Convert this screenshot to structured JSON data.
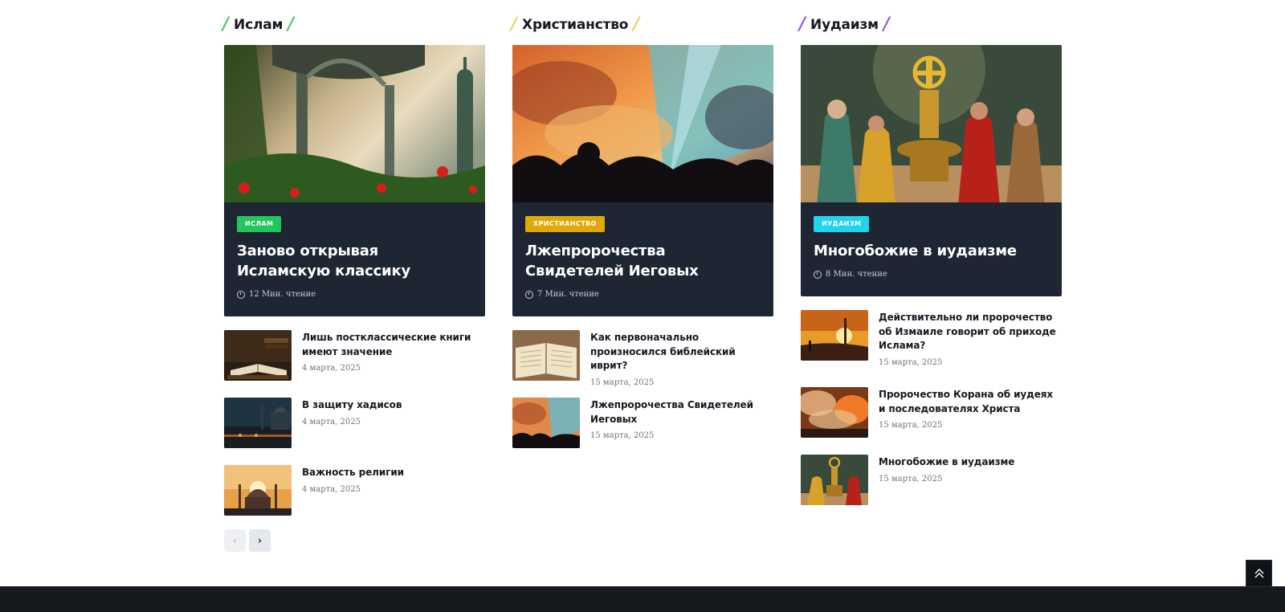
{
  "sections": [
    {
      "title": "Ислам",
      "slash_color": "#5cc46a",
      "featured": {
        "badge": "Ислам",
        "badge_color": "#22c55e",
        "title": "Заново открывая Исламскую классику",
        "read_time": "12 Мин. чтение"
      },
      "posts": [
        {
          "title": "Лишь постклассические книги имеют значение",
          "date": "4 марта, 2025"
        },
        {
          "title": "В защиту хадисов",
          "date": "4 марта, 2025"
        },
        {
          "title": "Важность религии",
          "date": "4 марта, 2025"
        }
      ]
    },
    {
      "title": "Христианство",
      "slash_color": "#f3d060",
      "featured": {
        "badge": "Христианство",
        "badge_color": "#e0a90b",
        "title": "Лжепророчества Свидетелей Иеговых",
        "read_time": "7 Мин. чтение"
      },
      "posts": [
        {
          "title": "Как первоначально произносился библейский иврит?",
          "date": "15 марта, 2025"
        },
        {
          "title": "Лжепророчества Свидетелей Иеговых",
          "date": "15 марта, 2025"
        }
      ]
    },
    {
      "title": "Иудаизм",
      "slash_color": "#9b5de5",
      "featured": {
        "badge": "Иудаизм",
        "badge_color": "#22d3ee",
        "title": "Многобожие в иудаизме",
        "read_time": "8 Мин. чтение"
      },
      "posts": [
        {
          "title": "Действительно ли пророчество об Измаиле говорит об приходе Ислама?",
          "date": "15 марта, 2025"
        },
        {
          "title": "Пророчество Корана об иудеях и последователях Христа",
          "date": "15 марта, 2025"
        },
        {
          "title": "Многобожие в иудаизме",
          "date": "15 марта, 2025"
        }
      ]
    }
  ],
  "pager": {
    "prev": "‹",
    "next": "›"
  },
  "icons": {
    "clock": "stopwatch-icon",
    "back_to_top": "double-chevron-up-icon"
  }
}
